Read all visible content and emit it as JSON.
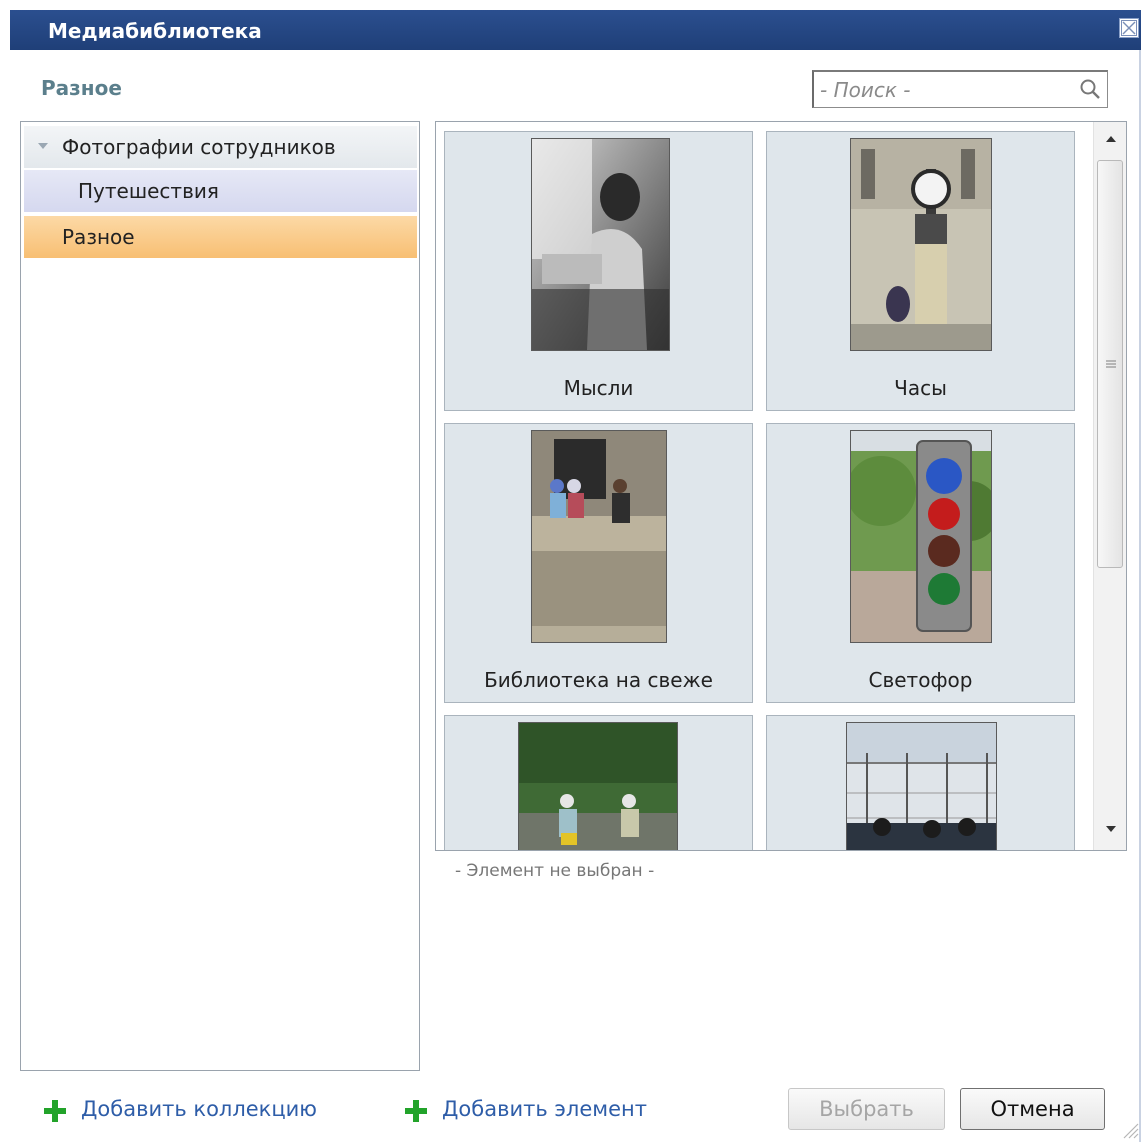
{
  "window": {
    "title": "Медиабиблиотека",
    "close_icon": "close-icon"
  },
  "header": {
    "section_title": "Разное"
  },
  "search": {
    "placeholder": "- Поиск -",
    "icon": "search-icon"
  },
  "tree": {
    "items": [
      {
        "label": "Фотографии сотрудников",
        "level": 0,
        "expanded": true,
        "state": "normal"
      },
      {
        "label": "Путешествия",
        "level": 1,
        "state": "highlighted"
      },
      {
        "label": "Разное",
        "level": 0,
        "state": "selected"
      }
    ]
  },
  "gallery": {
    "items": [
      {
        "label": "Мысли",
        "thumbnail": "woman-reading-photo"
      },
      {
        "label": "Часы",
        "thumbnail": "street-clock-photo"
      },
      {
        "label": "Библиотека на свеже",
        "thumbnail": "people-sitting-on-wall-photo"
      },
      {
        "label": "Светофор",
        "thumbnail": "traffic-light-photo"
      },
      {
        "label": "",
        "thumbnail": "cyclists-in-park-photo"
      },
      {
        "label": "",
        "thumbnail": "fence-and-sky-photo"
      }
    ]
  },
  "status": {
    "text": "- Элемент не выбран -"
  },
  "footer": {
    "add_collection": "Добавить коллекцию",
    "add_element": "Добавить элемент",
    "select_button": "Выбрать",
    "cancel_button": "Отмена"
  },
  "colors": {
    "titlebar": "#234684",
    "heading": "#5b7f8c",
    "selected_item": "#f8bf73",
    "link": "#2e5da8",
    "plus": "#22a32a",
    "tile_bg": "#dfe6eb"
  }
}
